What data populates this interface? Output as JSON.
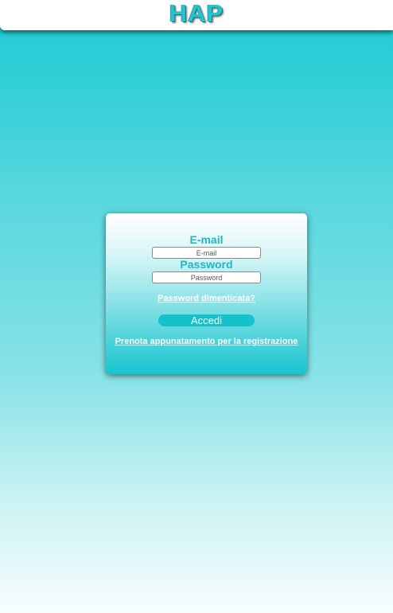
{
  "header": {
    "logo_text": "HAP"
  },
  "login": {
    "email_label": "E-mail",
    "email_placeholder": "E-mail",
    "email_value": "",
    "password_label": "Password",
    "password_placeholder": "Password",
    "password_value": "",
    "forgot_link": "Password dimenticata?",
    "submit_label": "Accedi",
    "register_link": "Prenota appunatamento per la registrazione"
  },
  "colors": {
    "accent": "#1ccbd3",
    "label": "#1fb6c2",
    "button": "#15c2cc",
    "header_bg": "#ffffff"
  }
}
